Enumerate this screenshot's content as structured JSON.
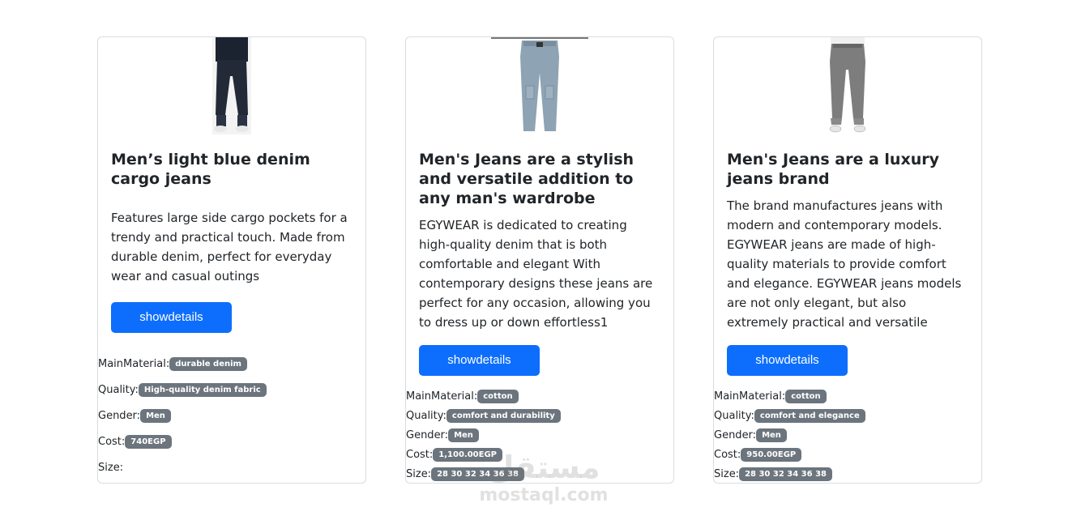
{
  "products": [
    {
      "title": "Men’s light blue denim cargo jeans",
      "description": "Features large side cargo pockets for a trendy and practical touch. Made from durable denim, perfect for everyday wear and casual outings",
      "button": "showdetails",
      "main_material_label": "MainMaterial:",
      "main_material": "durable denim",
      "quality_label": "Quality:",
      "quality": "High-quality denim fabric",
      "gender_label": "Gender:",
      "gender": "Men",
      "cost_label": "Cost:",
      "cost": "740EGP",
      "size_label": "Size:",
      "size": ""
    },
    {
      "title": "Men's Jeans are a stylish and versatile addition to any man's wardrobe",
      "description": "EGYWEAR is dedicated to creating high-quality denim that is both comfortable and elegant With contemporary designs these jeans are perfect for any occasion, allowing you to dress up or down effortless1",
      "button": "showdetails",
      "main_material_label": "MainMaterial:",
      "main_material": "cotton",
      "quality_label": "Quality:",
      "quality": "comfort and durability",
      "gender_label": "Gender:",
      "gender": "Men",
      "cost_label": "Cost:",
      "cost": "1,100.00EGP",
      "size_label": "Size:",
      "size": "28 30 32 34 36 38"
    },
    {
      "title": "Men's Jeans are a luxury jeans brand",
      "description": "The brand manufactures jeans with modern and contemporary models. EGYWEAR jeans are made of high-quality materials to provide comfort and elegance. EGYWEAR jeans models are not only elegant, but also extremely practical and versatile",
      "button": "showdetails",
      "main_material_label": "MainMaterial:",
      "main_material": "cotton",
      "quality_label": "Quality:",
      "quality": "comfort and elegance",
      "gender_label": "Gender:",
      "gender": "Men",
      "cost_label": "Cost:",
      "cost": "950.00EGP",
      "size_label": "Size:",
      "size": "28 30 32 34 36 38"
    }
  ],
  "watermark": {
    "arabic": "مستقل",
    "latin": "mostaql.com"
  },
  "colors": {
    "primary": "#0d6efd",
    "badge": "#6c757d",
    "border": "#d9dcdf"
  }
}
